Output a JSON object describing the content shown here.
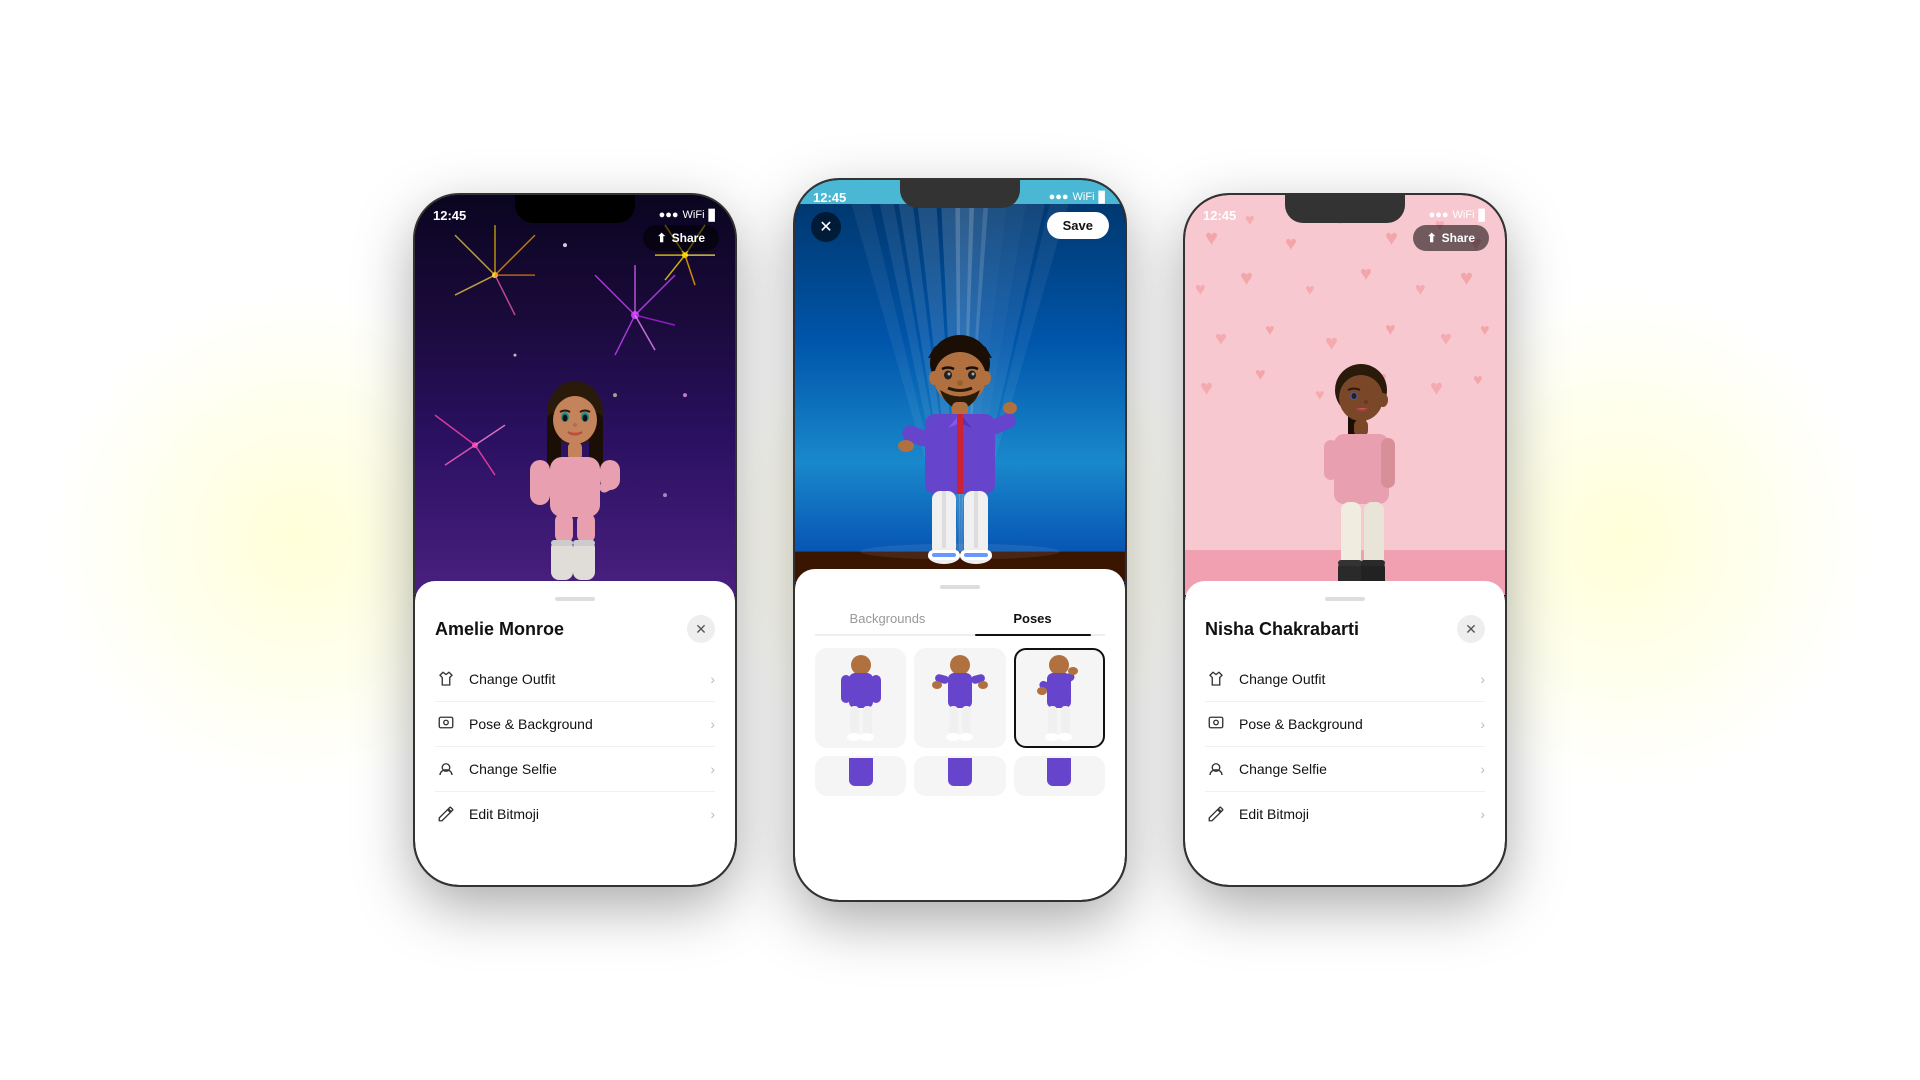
{
  "scene": {
    "bg_color": "#ffffff"
  },
  "phone_left": {
    "status_time": "12:45",
    "top_button": "Share",
    "avatar_name": "Amelie Monroe",
    "menu_items": [
      {
        "icon": "outfit",
        "label": "Change Outfit"
      },
      {
        "icon": "pose",
        "label": "Pose & Background"
      },
      {
        "icon": "selfie",
        "label": "Change Selfie"
      },
      {
        "icon": "edit",
        "label": "Edit Bitmoji"
      }
    ]
  },
  "phone_center": {
    "status_time": "12:45",
    "top_left_button": "✕",
    "top_right_button": "Save",
    "tabs": [
      "Backgrounds",
      "Poses"
    ],
    "active_tab": "Poses"
  },
  "phone_right": {
    "status_time": "12:45",
    "top_button": "Share",
    "avatar_name": "Nisha Chakrabarti",
    "menu_items": [
      {
        "icon": "outfit",
        "label": "Change Outfit"
      },
      {
        "icon": "pose",
        "label": "Pose & Background"
      },
      {
        "icon": "selfie",
        "label": "Change Selfie"
      },
      {
        "icon": "edit",
        "label": "Edit Bitmoji"
      }
    ]
  }
}
